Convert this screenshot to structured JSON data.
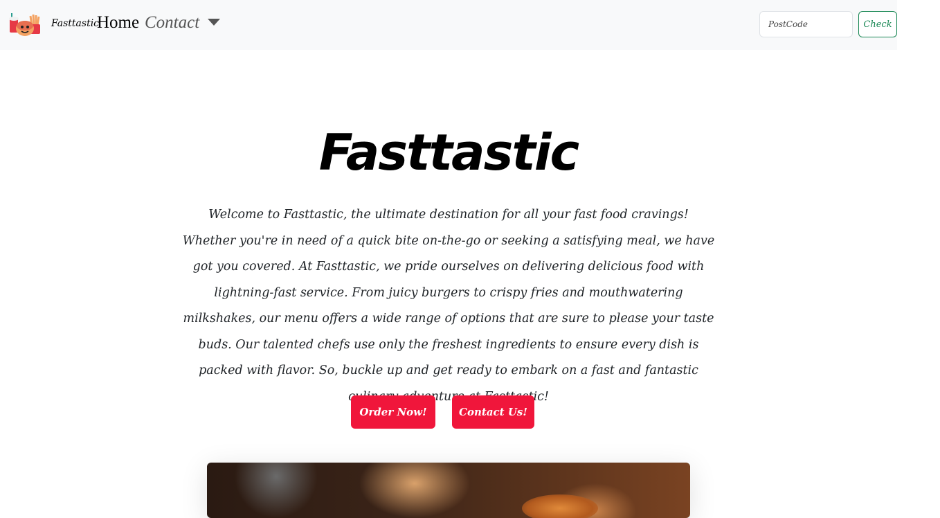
{
  "nav": {
    "brand": "Fasttastic",
    "home": "Home",
    "contact": "Contact",
    "postcode_placeholder": "PostCode",
    "check_label": "Check"
  },
  "hero": {
    "title": "Fasttastic",
    "text": "Welcome to Fasttastic, the ultimate destination for all your fast food cravings! Whether you're in need of a quick bite on-the-go or seeking a satisfying meal, we have got you covered. At Fasttastic, we pride ourselves on delivering delicious food with lightning-fast service. From juicy burgers to crispy fries and mouthwatering milkshakes, our menu offers a wide range of options that are sure to please your taste buds. Our talented chefs use only the freshest ingredients to ensure every dish is packed with flavor. So, buckle up and get ready to embark on a fast and fantastic culinary adventure at Fasttastic!",
    "order_label": "Order Now!",
    "contact_label": "Contact Us!"
  },
  "colors": {
    "accent_red": "#f0163b",
    "check_green": "#198754",
    "navbar_bg": "#f8f9fa"
  },
  "icons": {
    "logo": "fast-food-logo-icon",
    "dropdown": "caret-down-icon"
  }
}
